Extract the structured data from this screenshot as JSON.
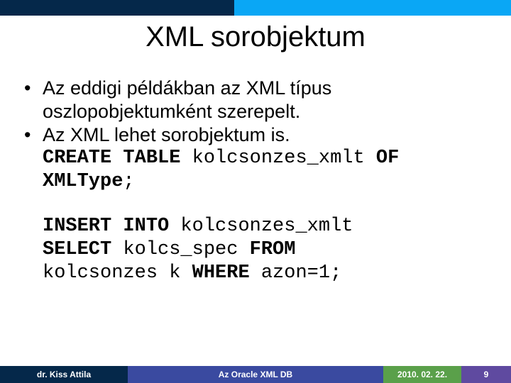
{
  "title": "XML sorobjektum",
  "bullets": {
    "b1": "Az eddigi példákban az XML típus oszlopobjektumként szerepelt.",
    "b2": "Az XML lehet sorobjektum is."
  },
  "code1": {
    "kw_create_table": "CREATE TABLE",
    "table_name_1": " kolcsonzes_xmlt ",
    "kw_of": "OF",
    "type_line": "XMLType",
    "semicolon1": ";"
  },
  "code2": {
    "kw_insert_into": "INSERT INTO",
    "tbl": " kolcsonzes_xmlt ",
    "kw_select": "SELECT",
    "col": " kolcs_spec ",
    "kw_from": "FROM",
    "rest": " kolcsonzes k ",
    "kw_where": "WHERE",
    "cond": " azon=1;"
  },
  "footer": {
    "author": "dr. Kiss Attila",
    "subject": "Az Oracle XML DB",
    "date": "2010. 02. 22.",
    "page": "9"
  },
  "dot": "•"
}
